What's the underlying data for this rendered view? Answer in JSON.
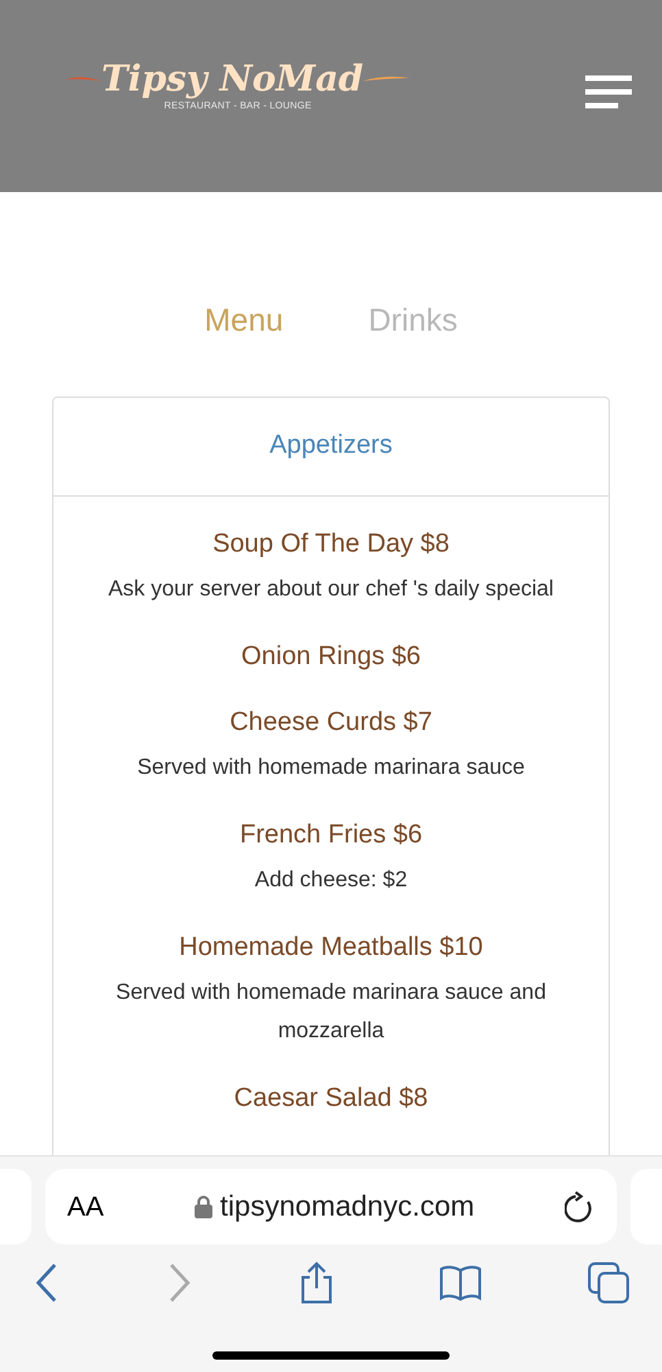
{
  "header": {
    "logo": {
      "name": "Tipsy NoMad",
      "tagline": "RESTAURANT - BAR - LOUNGE"
    }
  },
  "tabs": [
    {
      "label": "Menu",
      "selected": true
    },
    {
      "label": "Drinks",
      "selected": false
    }
  ],
  "section": {
    "title": "Appetizers",
    "items": [
      {
        "name": "Soup Of The Day $8",
        "description": "Ask your server about our chef 's daily special"
      },
      {
        "name": "Onion Rings $6"
      },
      {
        "name": "Cheese Curds $7",
        "description": "Served with homemade marinara sauce"
      },
      {
        "name": "French Fries $6",
        "description": "Add cheese: $2"
      },
      {
        "name": "Homemade Meatballs $10",
        "description": "Served with homemade marinara sauce and mozzarella"
      },
      {
        "name": "Caesar Salad $8"
      }
    ]
  },
  "browser": {
    "text_size_button": "AA",
    "url": "tipsynomadnyc.com",
    "back_enabled": true,
    "forward_enabled": false
  }
}
